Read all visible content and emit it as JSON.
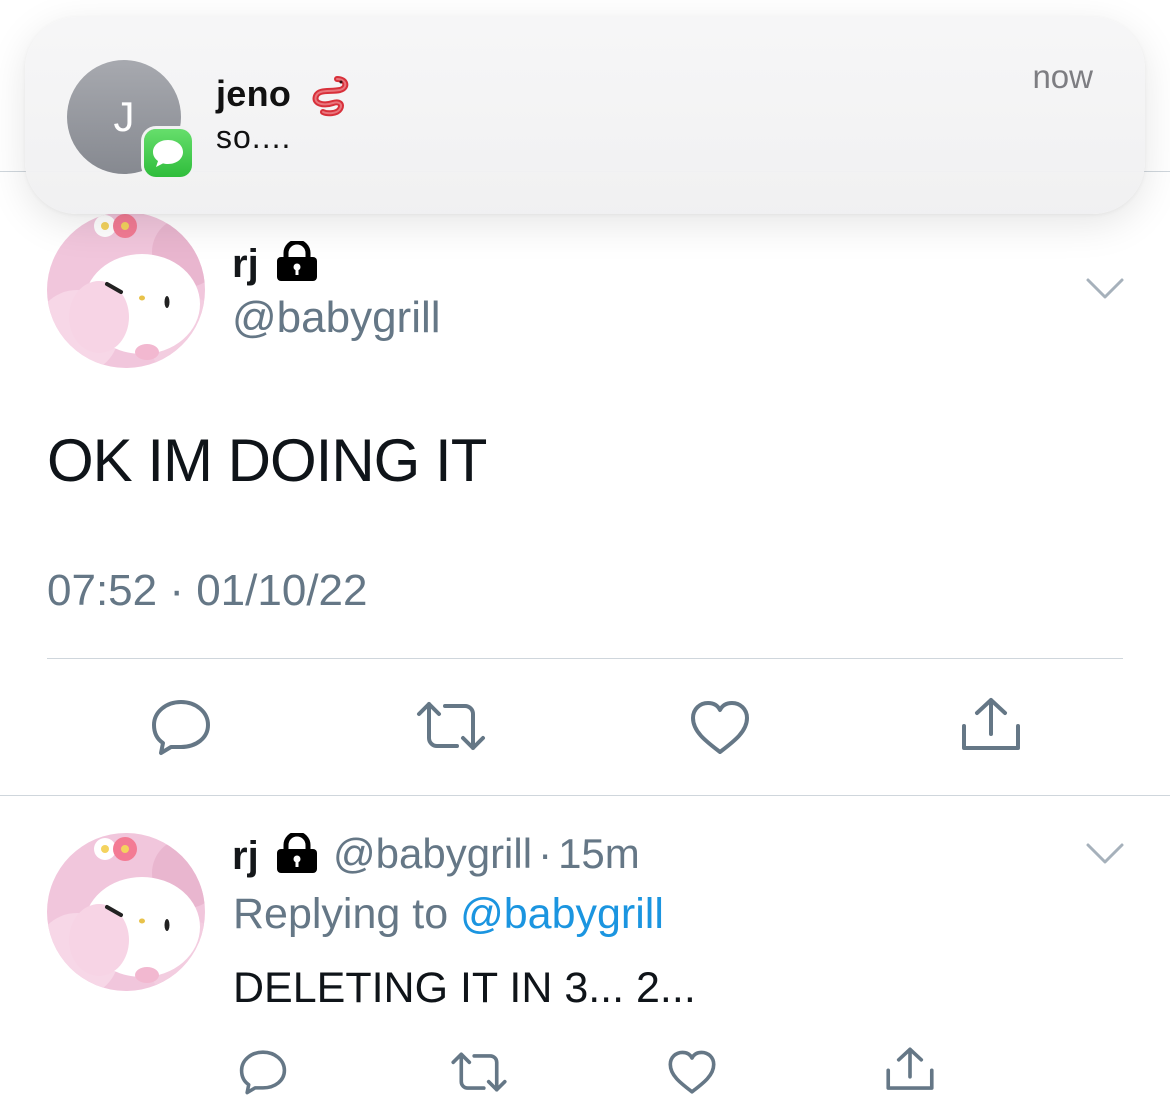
{
  "notification": {
    "avatar_initial": "J",
    "app_icon": "messages-icon",
    "sender": "jeno",
    "sender_emoji": "worm-emoji",
    "message": "so....",
    "time": "now"
  },
  "main_tweet": {
    "display_name": "rj",
    "protected_icon": "lock-icon",
    "handle": "@babygrill",
    "text": "OK IM DOING IT",
    "timestamp": "07:52 · 01/10/22",
    "actions": [
      "reply-icon",
      "retweet-icon",
      "like-icon",
      "share-icon"
    ]
  },
  "reply_tweet": {
    "display_name": "rj",
    "protected_icon": "lock-icon",
    "handle": "@babygrill",
    "separator": "·",
    "age": "15m",
    "replying_prefix": "Replying to",
    "replying_handle": "@babygrill",
    "text": "DELETING IT IN 3... 2...",
    "actions": [
      "reply-icon",
      "retweet-icon",
      "like-icon",
      "share-icon"
    ]
  },
  "colors": {
    "secondary_text": "#657786",
    "link": "#1b95e0",
    "avatar_pink": "#f1c6dc",
    "imessage_green": "#34c759"
  }
}
